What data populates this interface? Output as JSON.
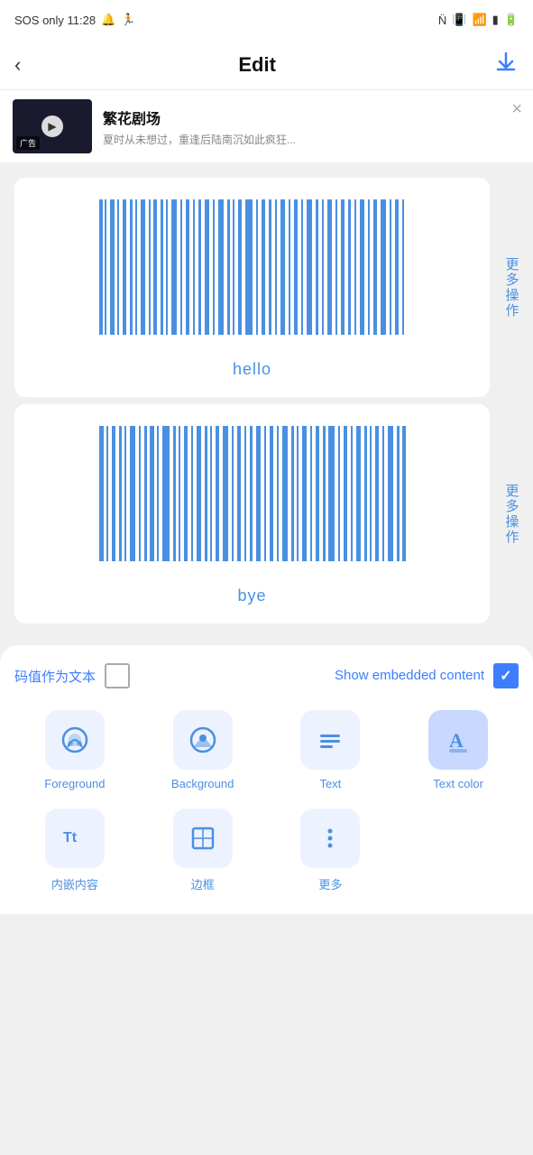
{
  "statusBar": {
    "left": "SOS only  11:28",
    "bellIcon": "🔔",
    "runIcon": "🏃",
    "nfcIcon": "N",
    "vibrateIcon": "📳",
    "wifiIcon": "📶",
    "batteryIcon": "🔋"
  },
  "header": {
    "backLabel": "‹",
    "title": "Edit",
    "downloadIcon": "⬇"
  },
  "adBanner": {
    "title": "繁花剧场",
    "subtitle": "夏时从未想过，重逢后陆南沉如此疯狂...",
    "adLabel": "广告",
    "closeIcon": "×"
  },
  "barcodes": [
    {
      "label": "hello",
      "id": "bc1"
    },
    {
      "label": "bye",
      "id": "bc2"
    }
  ],
  "moreActionsLabel": "更多操作",
  "bottomPanel": {
    "toggleLeft": {
      "label": "码值作为文本",
      "checked": false
    },
    "toggleRight": {
      "label": "Show embedded content",
      "checked": true
    },
    "tools": [
      {
        "id": "foreground",
        "icon": "🎨",
        "label": "Foreground",
        "active": false
      },
      {
        "id": "background",
        "icon": "🎨",
        "label": "Background",
        "active": false
      },
      {
        "id": "text",
        "icon": "≡",
        "label": "Text",
        "active": false
      },
      {
        "id": "textcolor",
        "icon": "A",
        "label": "Text color",
        "active": true
      }
    ],
    "toolsBottom": [
      {
        "id": "embedded",
        "icon": "Tt",
        "label": "内嵌内容",
        "active": false
      },
      {
        "id": "border",
        "icon": "⊞",
        "label": "边框",
        "active": false
      },
      {
        "id": "more",
        "icon": "⋮",
        "label": "更多",
        "active": false
      }
    ]
  }
}
